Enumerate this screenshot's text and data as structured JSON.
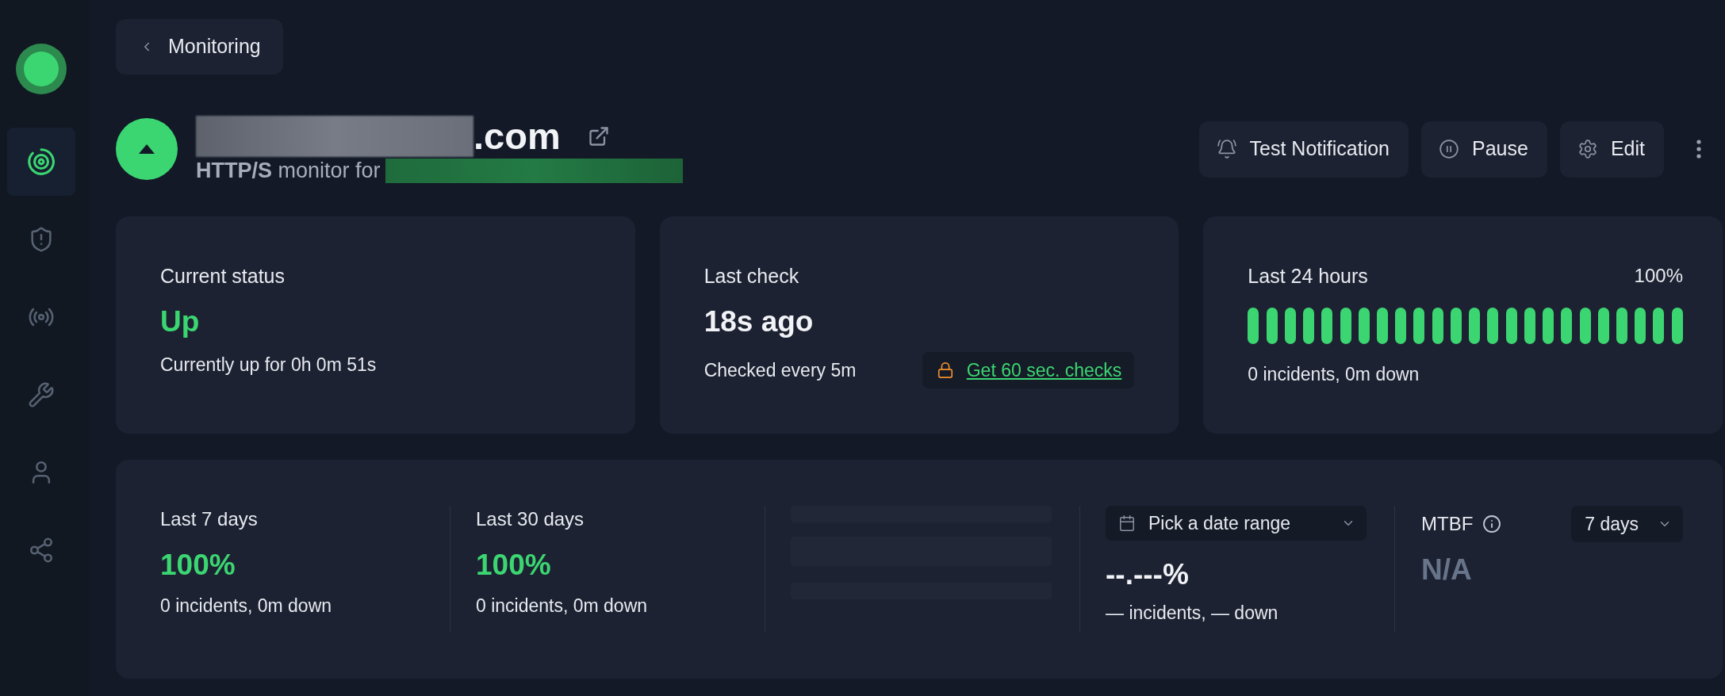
{
  "sidebar": {
    "items": [
      {
        "selected": true
      },
      {
        "selected": false
      },
      {
        "selected": false
      },
      {
        "selected": false
      },
      {
        "selected": false
      },
      {
        "selected": false
      }
    ]
  },
  "back_button": {
    "label": "Monitoring"
  },
  "monitor": {
    "up": true,
    "title": ".com",
    "subtitle": "**HTTP/S** monitor for"
  },
  "actions": [
    {
      "label": "Test Notification"
    },
    {
      "label": "Pause"
    },
    {
      "label": "Edit"
    }
  ],
  "current_status": {
    "label": "Current status",
    "value": "Up",
    "detail": "Currently up for 0h 0m 51s"
  },
  "last_check": {
    "label": "Last check",
    "value": "18s ago",
    "detail": "Checked every 5m",
    "upgrade_link": "Get 60 sec. checks"
  },
  "last_24_hours": {
    "label": "Last 24 hours",
    "percent": "100%",
    "bars": [
      {
        "up": true
      },
      {
        "up": true
      },
      {
        "up": true
      },
      {
        "up": true
      },
      {
        "up": true
      },
      {
        "up": true
      },
      {
        "up": true
      },
      {
        "up": true
      },
      {
        "up": true
      },
      {
        "up": true
      },
      {
        "up": true
      },
      {
        "up": true
      },
      {
        "up": true
      },
      {
        "up": true
      },
      {
        "up": true
      },
      {
        "up": true
      },
      {
        "up": true
      },
      {
        "up": true
      },
      {
        "up": true
      },
      {
        "up": true
      },
      {
        "up": true
      },
      {
        "up": true
      },
      {
        "up": true
      },
      {
        "up": true
      }
    ],
    "detail": "0 incidents, 0m down"
  },
  "periods": [
    {
      "label": "Last 7 days",
      "percent": "100%",
      "detail": "0 incidents, 0m down"
    },
    {
      "label": "Last 30 days",
      "percent": "100%",
      "detail": "0 incidents, 0m down"
    }
  ],
  "custom_range": {
    "picker_label": "Pick a date range",
    "percent": "--.---%",
    "detail": "— incidents, — down"
  },
  "mtbf": {
    "label": "MTBF",
    "range": "7 days",
    "value": "N/A"
  }
}
